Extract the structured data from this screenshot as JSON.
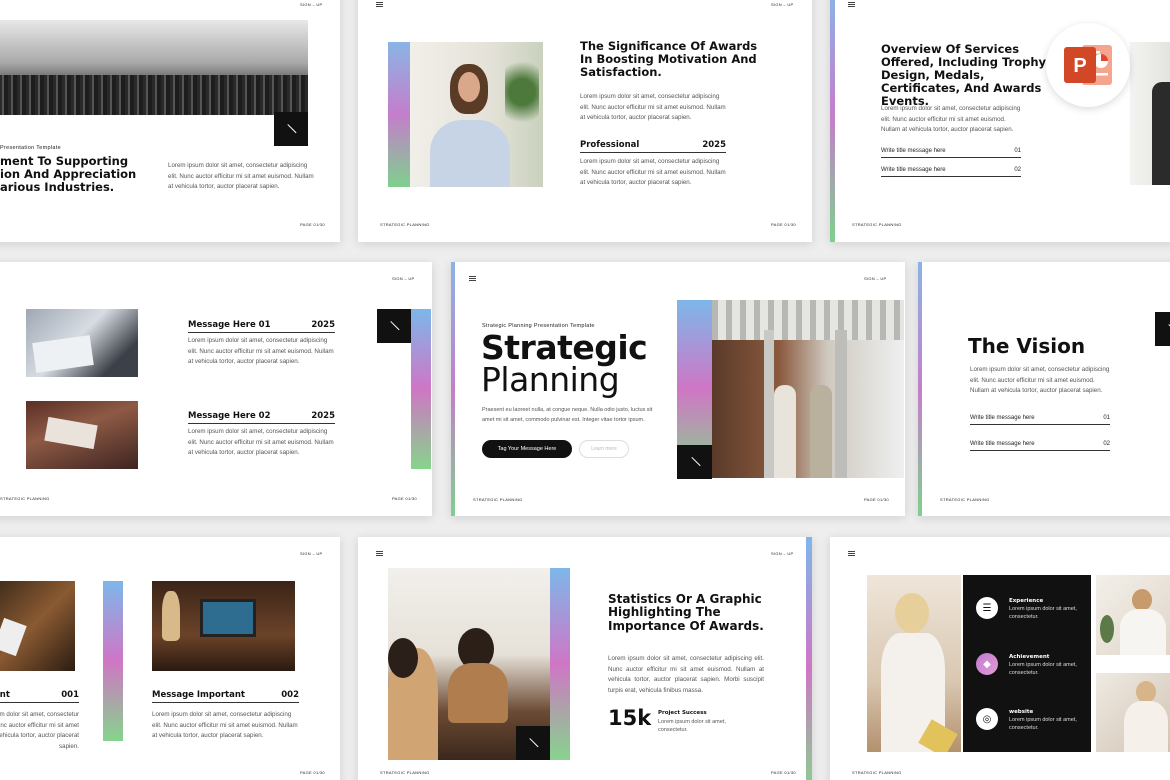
{
  "common": {
    "sign_up": "SIGN – UP",
    "footer_left": "STRATEGIC PLANNING",
    "page": "PAGE 01/30",
    "lorem3": "Lorem ipsum dolor sit amet, consectetur adipiscing elit. Nunc auctor efficitur mi sit amet euismod. Nullam at vehicula tortor, auctor placerat sapien.",
    "lorem_short": "Lorem ipsum dolor sit amet, consectetur."
  },
  "slide1": {
    "kicker": "Presentation Template",
    "heading": "ment To Supporting\nion And Appreciation\narious Industries."
  },
  "slide2": {
    "heading": "The Significance Of Awards In Boosting Motivation And Satisfaction.",
    "row_label": "Professional",
    "row_year": "2025"
  },
  "slide3": {
    "heading": "Overview Of Services Offered, Including Trophy Design, Medals, Certificates, And Awards Events.",
    "lines": [
      {
        "label": "Write title message here",
        "num": "01"
      },
      {
        "label": "Write title message here",
        "num": "02"
      }
    ]
  },
  "slide4": {
    "items": [
      {
        "title": "Message Here 01",
        "year": "2025"
      },
      {
        "title": "Message Here 02",
        "year": "2025"
      }
    ]
  },
  "slide5": {
    "kicker": "Strategic Planning Presentation Template",
    "title1": "Strategic",
    "title2": "Planning",
    "body": "Praesent eu laoreet nulla, at congue neque. Nulla odio justo, luctus sit amet mi sit amet, commodo pulvinar est. Integer vitae tortor ipsum.",
    "primary_button": "Tag Your Message Here",
    "secondary_button": "Learn more"
  },
  "slide6": {
    "heading": "The Vision",
    "lines": [
      {
        "label": "Write title message here",
        "num": "01"
      },
      {
        "label": "Write title message here",
        "num": "02"
      }
    ]
  },
  "slide7": {
    "items": [
      {
        "title": "tant",
        "num": "001"
      },
      {
        "title": "Message Important",
        "num": "002"
      }
    ]
  },
  "slide8": {
    "heading": "Statistics Or A Graphic Highlighting The Importance Of Awards.",
    "body": "Lorem ipsum dolor sit amet, consectetur adipiscing elit. Nunc auctor efficitur mi sit amet euismod. Nullam at vehicula tortor, auctor placerat sapien. Morbi suscipit turpis erat, vehicula finibus massa.",
    "stat": "15k",
    "stat_label": "Project Success"
  },
  "slide9": {
    "features": [
      {
        "title": "Experience",
        "icon": "list-icon"
      },
      {
        "title": "Achievement",
        "icon": "layers-icon"
      },
      {
        "title": "website",
        "icon": "globe-icon"
      }
    ]
  },
  "badge": {
    "letter": "P",
    "icon": "powerpoint-icon"
  }
}
